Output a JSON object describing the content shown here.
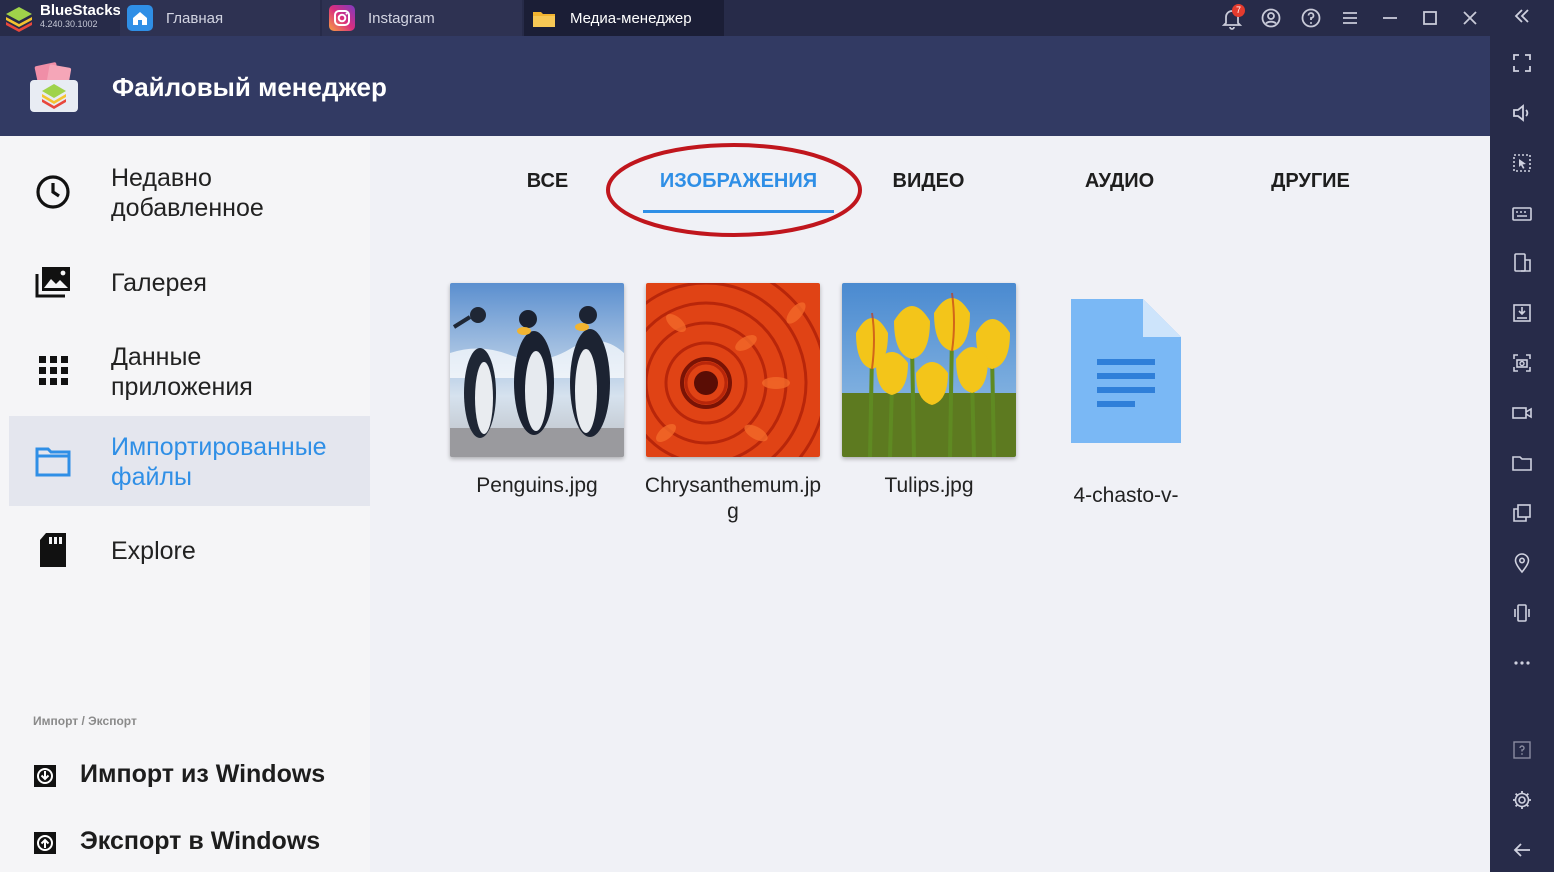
{
  "titlebar": {
    "brand": "BlueStacks",
    "version": "4.240.30.1002",
    "notification_count": "7",
    "tabs": [
      {
        "label": "Главная",
        "icon": "home-icon"
      },
      {
        "label": "Instagram",
        "icon": "instagram-icon"
      },
      {
        "label": "Медиа-менеджер",
        "icon": "folder-icon",
        "active": true
      }
    ]
  },
  "app": {
    "title": "Файловый менеджер"
  },
  "nav": {
    "items": [
      {
        "label": "Недавно\nдобавленное",
        "icon": "clock-icon"
      },
      {
        "label": "Галерея",
        "icon": "gallery-icon"
      },
      {
        "label": "Данные\nприложения",
        "icon": "grid-icon"
      },
      {
        "label": "Импортированные\nфайлы",
        "icon": "folder-icon",
        "active": true
      },
      {
        "label": "Explore",
        "icon": "sd-card-icon"
      }
    ],
    "section_label": "Импорт / Экспорт",
    "import_label": "Импорт из Windows",
    "export_label": "Экспорт в Windows"
  },
  "categories": {
    "tabs": [
      "ВСЕ",
      "ИЗОБРАЖЕНИЯ",
      "ВИДЕО",
      "АУДИО",
      "ДРУГИЕ"
    ],
    "active_index": 1
  },
  "files": [
    {
      "name": "Penguins.jpg",
      "thumb": "penguins"
    },
    {
      "name": "Chrysanthemum.jpg",
      "thumb": "chrysanthemum"
    },
    {
      "name": "Tulips.jpg",
      "thumb": "tulips"
    },
    {
      "name": "4-chasto-v-",
      "thumb": "document"
    }
  ],
  "colors": {
    "accent": "#2f8fe6",
    "header": "#323a63",
    "highlight_circle": "#c0161d"
  }
}
